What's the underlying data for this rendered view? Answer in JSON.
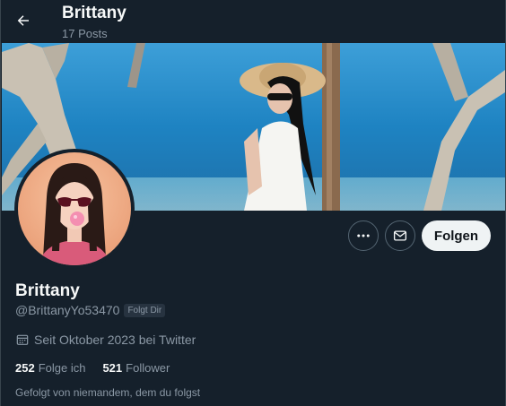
{
  "header": {
    "name": "Brittany",
    "posts": "17 Posts"
  },
  "profile": {
    "name": "Brittany",
    "handle": "@BrittanyYo53470",
    "follows_you_badge": "Folgt Dir",
    "joined": "Seit Oktober 2023 bei Twitter",
    "following_count": "252",
    "following_label": "Folge ich",
    "followers_count": "521",
    "followers_label": "Follower",
    "followed_by": "Gefolgt von niemandem, dem du folgst"
  },
  "actions": {
    "follow_label": "Folgen"
  },
  "icons": {
    "back": "arrow-left-icon",
    "more": "more-dots-icon",
    "message": "envelope-icon",
    "calendar": "calendar-icon"
  },
  "colors": {
    "background": "#15202b",
    "text_primary": "#f7f9f9",
    "text_secondary": "#8b98a5",
    "button_border": "#536471",
    "follow_button_bg": "#eff3f4"
  }
}
